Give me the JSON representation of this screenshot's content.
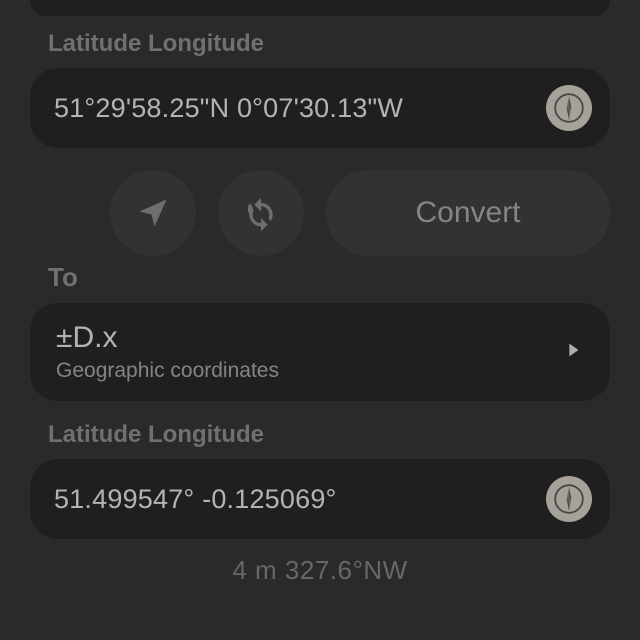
{
  "input": {
    "section_label": "Latitude Longitude",
    "value": "51°29'58.25\"N 0°07'30.13\"W"
  },
  "actions": {
    "convert_label": "Convert"
  },
  "to_label": "To",
  "format": {
    "title": "±D.x",
    "subtitle": "Geographic coordinates"
  },
  "output": {
    "section_label": "Latitude Longitude",
    "value": "51.499547°  -0.125069°"
  },
  "footer": "4 m 327.6°NW"
}
